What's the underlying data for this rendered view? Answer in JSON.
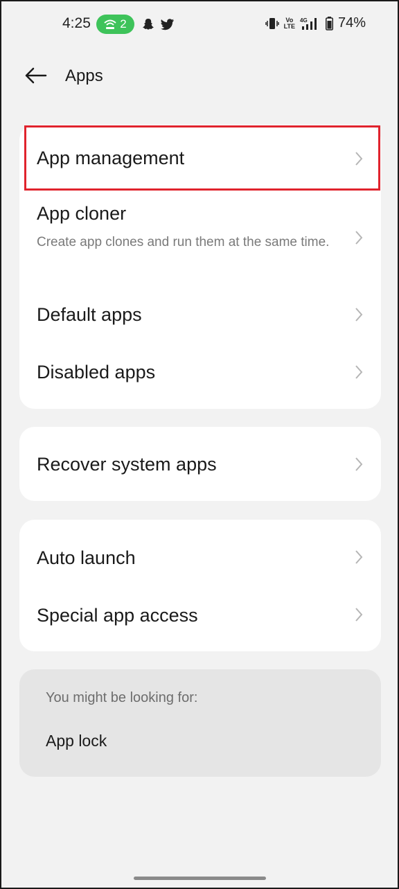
{
  "status_bar": {
    "time": "4:25",
    "hotspot_count": "2",
    "network_label": "Vo LTE",
    "network_type": "4G",
    "battery": "74%",
    "icons": [
      "wifi-hotspot-icon",
      "snapchat-icon",
      "twitter-icon",
      "vibrate-icon",
      "signal-icon",
      "battery-icon"
    ]
  },
  "header": {
    "title": "Apps",
    "back_icon": "back-arrow-icon"
  },
  "groups": [
    {
      "items": [
        {
          "title": "App management"
        },
        {
          "title": "App cloner",
          "subtitle": "Create app clones and run them at the same time."
        },
        {
          "title": "Default apps"
        },
        {
          "title": "Disabled apps"
        }
      ]
    },
    {
      "items": [
        {
          "title": "Recover system apps"
        }
      ]
    },
    {
      "items": [
        {
          "title": "Auto launch"
        },
        {
          "title": "Special app access"
        }
      ]
    }
  ],
  "suggestions": {
    "label": "You might be looking for:",
    "items": [
      "App lock"
    ]
  },
  "colors": {
    "background": "#f2f2f2",
    "card": "#ffffff",
    "highlight": "#e0232d",
    "hotspot": "#3ec35a"
  }
}
